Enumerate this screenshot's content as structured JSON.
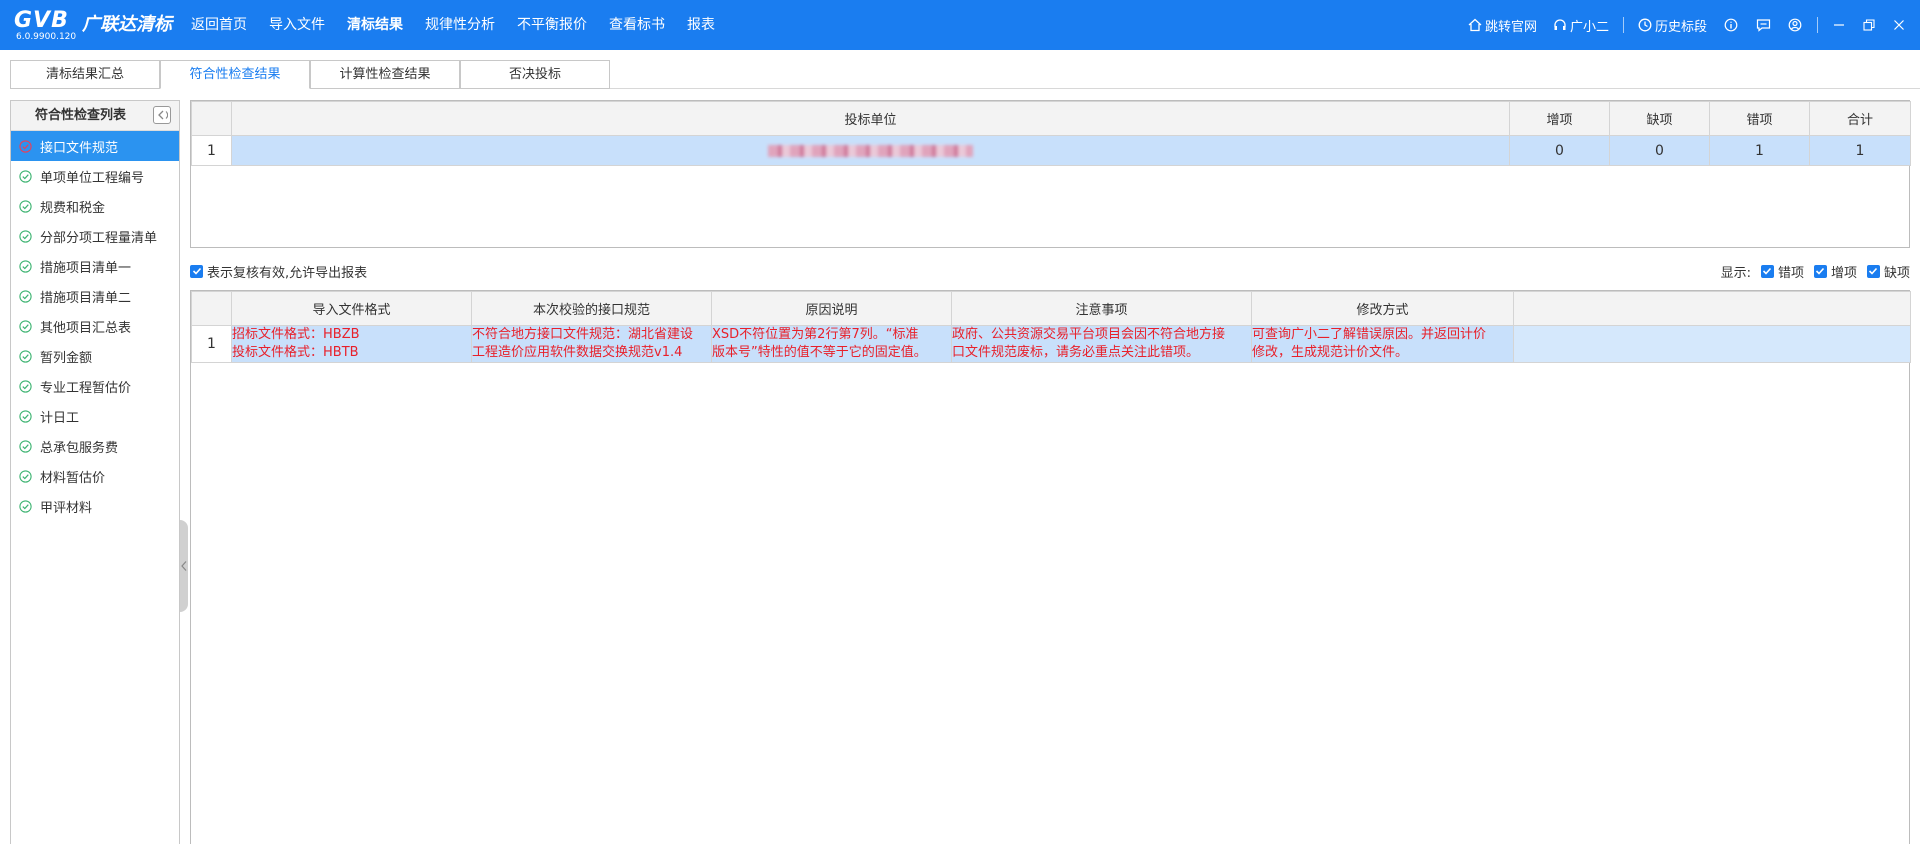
{
  "app": {
    "brand": "GVB",
    "brand_cn": "广联达清标",
    "version": "6.0.9900.120"
  },
  "nav": [
    {
      "label": "返回首页",
      "active": false
    },
    {
      "label": "导入文件",
      "active": false
    },
    {
      "label": "清标结果",
      "active": true
    },
    {
      "label": "规律性分析",
      "active": false
    },
    {
      "label": "不平衡报价",
      "active": false
    },
    {
      "label": "查看标书",
      "active": false
    },
    {
      "label": "报表",
      "active": false
    }
  ],
  "topright": {
    "website": "跳转官网",
    "assistant": "广小二",
    "history": "历史标段"
  },
  "tabs": [
    {
      "label": "清标结果汇总",
      "active": false
    },
    {
      "label": "符合性检查结果",
      "active": true
    },
    {
      "label": "计算性检查结果",
      "active": false
    },
    {
      "label": "否决投标",
      "active": false
    }
  ],
  "leftpanel": {
    "title": "符合性检查列表",
    "items": [
      {
        "label": "接口文件规范",
        "active": true
      },
      {
        "label": "单项单位工程编号",
        "active": false
      },
      {
        "label": "规费和税金",
        "active": false
      },
      {
        "label": "分部分项工程量清单",
        "active": false
      },
      {
        "label": "措施项目清单一",
        "active": false
      },
      {
        "label": "措施项目清单二",
        "active": false
      },
      {
        "label": "其他项目汇总表",
        "active": false
      },
      {
        "label": "暂列金额",
        "active": false
      },
      {
        "label": "专业工程暂估价",
        "active": false
      },
      {
        "label": "计日工",
        "active": false
      },
      {
        "label": "总承包服务费",
        "active": false
      },
      {
        "label": "材料暂估价",
        "active": false
      },
      {
        "label": "甲评材料",
        "active": false
      }
    ]
  },
  "grid1": {
    "headers": [
      "投标单位",
      "增项",
      "缺项",
      "错项",
      "合计"
    ],
    "rows": [
      {
        "no": "1",
        "add": "0",
        "missing": "0",
        "wrong": "1",
        "total": "1"
      }
    ]
  },
  "bar": {
    "valid_label": "表示复核有效,允许导出报表",
    "display_label": "显示:",
    "opt_wrong": "错项",
    "opt_add": "增项",
    "opt_missing": "缺项"
  },
  "grid2": {
    "headers": [
      "导入文件格式",
      "本次校验的接口规范",
      "原因说明",
      "注意事项",
      "修改方式"
    ],
    "rows": [
      {
        "no": "1",
        "format_1": "招标文件格式：HBZB",
        "format_2": "投标文件格式：HBTB",
        "spec_1": "不符合地方接口文件规范：湖北省建设",
        "spec_2": "工程造价应用软件数据交换规范v1.4",
        "reason_1": "XSD不符位置为第2行第7列。“标准",
        "reason_2": "版本号”特性的值不等于它的固定值。",
        "note_1": "政府、公共资源交易平台项目会因不符合地方接",
        "note_2": "口文件规范废标，请务必重点关注此错项。",
        "fix_1": "可查询广小二了解错误原因。并返回计价",
        "fix_2": "修改，生成规范计价文件。"
      }
    ]
  },
  "colors": {
    "primary": "#1a7df0",
    "selected_row": "#c8e0fb",
    "error_text": "#e8202a",
    "check": "#3cb371"
  }
}
